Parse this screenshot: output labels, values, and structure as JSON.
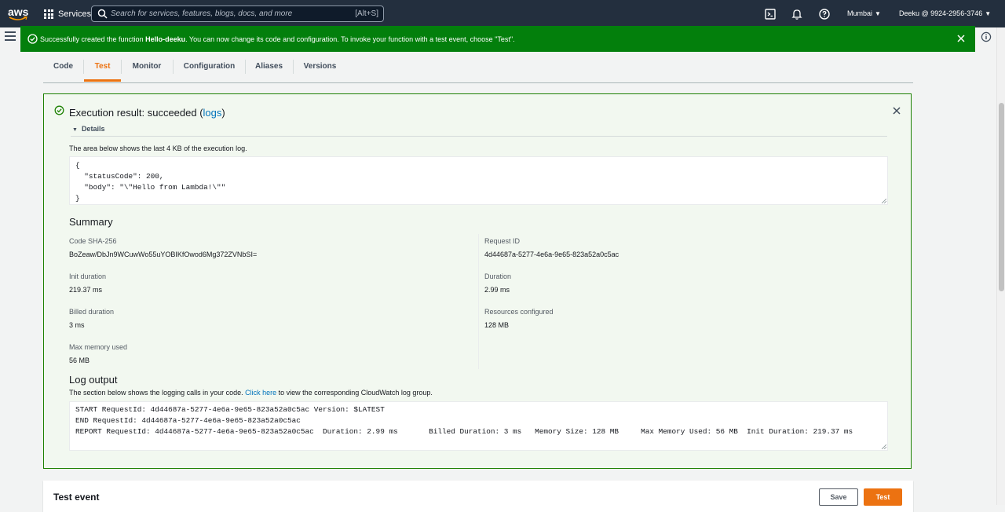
{
  "topnav": {
    "logo_text": "aws",
    "services_label": "Services",
    "search_placeholder": "Search for services, features, blogs, docs, and more",
    "search_shortcut": "[Alt+S]",
    "region": "Mumbai",
    "account": "Deeku @ 9924-2956-3746"
  },
  "flash": {
    "prefix": "Successfully created the function ",
    "function_name": "Hello-deeku",
    "suffix": ". You can now change its code and configuration. To invoke your function with a test event, choose \"Test\".",
    "background": "#037f0c"
  },
  "tabs": [
    {
      "label": "Code"
    },
    {
      "label": "Test"
    },
    {
      "label": "Monitor"
    },
    {
      "label": "Configuration"
    },
    {
      "label": "Aliases"
    },
    {
      "label": "Versions"
    }
  ],
  "active_tab": "Test",
  "result": {
    "title_prefix": "Execution result: succeeded (",
    "title_link": "logs",
    "title_suffix": ")",
    "details_label": "Details",
    "description": "The area below shows the last 4 KB of the execution log.",
    "output": "{\n  \"statusCode\": 200,\n  \"body\": \"\\\"Hello from Lambda!\\\"\"\n}",
    "summary_heading": "Summary",
    "summary": {
      "code_sha_label": "Code SHA-256",
      "code_sha_value": "BoZeaw/DbJn9WCuwWo55uYOBIKfOwod6Mg372ZVNbSI=",
      "request_id_label": "Request ID",
      "request_id_value": "4d44687a-5277-4e6a-9e65-823a52a0c5ac",
      "init_duration_label": "Init duration",
      "init_duration_value": "219.37 ms",
      "duration_label": "Duration",
      "duration_value": "2.99 ms",
      "billed_duration_label": "Billed duration",
      "billed_duration_value": "3 ms",
      "resources_label": "Resources configured",
      "resources_value": "128 MB",
      "max_memory_label": "Max memory used",
      "max_memory_value": "56 MB"
    },
    "log_heading": "Log output",
    "log_desc_prefix": "The section below shows the logging calls in your code. ",
    "log_desc_link": "Click here",
    "log_desc_suffix": " to view the corresponding CloudWatch log group.",
    "log_text": "START RequestId: 4d44687a-5277-4e6a-9e65-823a52a0c5ac Version: $LATEST\nEND RequestId: 4d44687a-5277-4e6a-9e65-823a52a0c5ac\nREPORT RequestId: 4d44687a-5277-4e6a-9e65-823a52a0c5ac  Duration: 2.99 ms       Billed Duration: 3 ms   Memory Size: 128 MB     Max Memory Used: 56 MB  Init Duration: 219.37 ms"
  },
  "test_event": {
    "heading": "Test event",
    "save_label": "Save",
    "test_label": "Test"
  },
  "colors": {
    "accent": "#ec7211",
    "link": "#0073bb",
    "success": "#1d8102",
    "nav_bg": "#232f3e"
  }
}
